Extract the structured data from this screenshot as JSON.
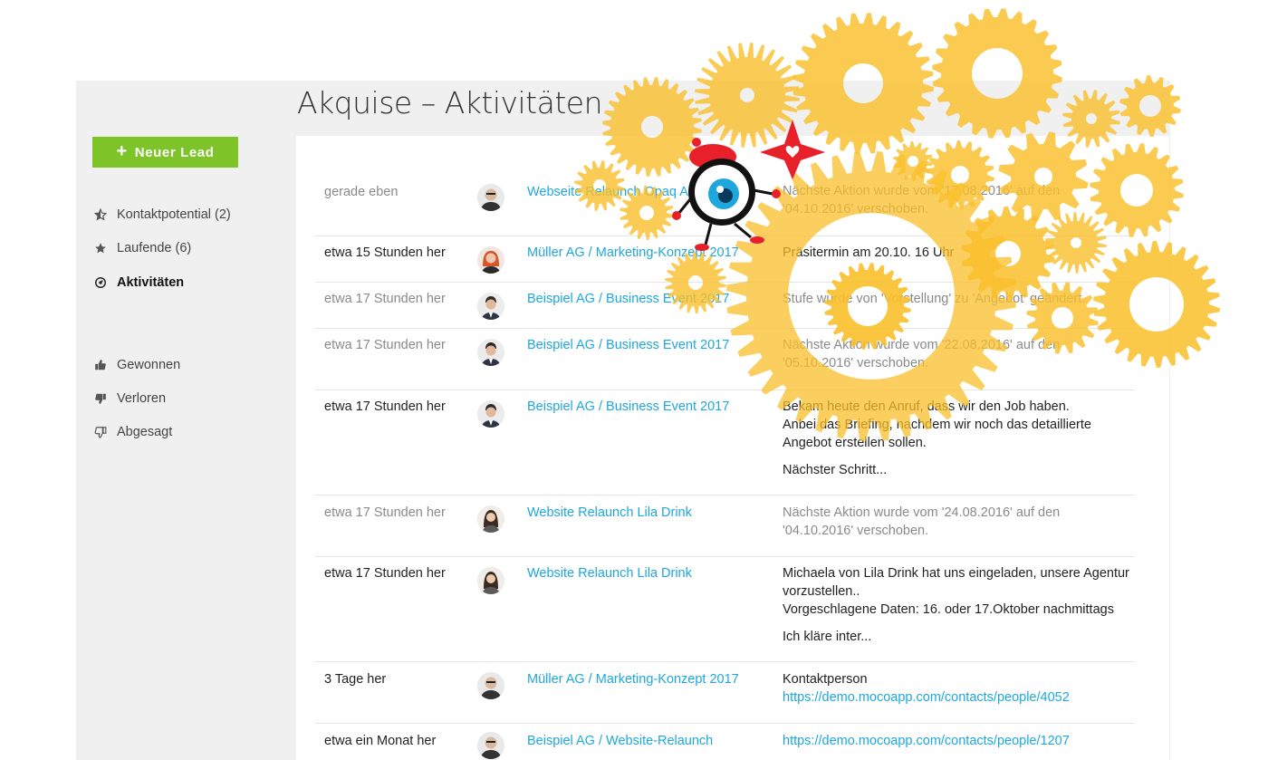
{
  "page": {
    "title": "Akquise – Aktivitäten"
  },
  "sidebar": {
    "new_lead_label": "Neuer Lead",
    "items": [
      {
        "label": "Kontaktpotential (2)",
        "icon": "star-half-icon"
      },
      {
        "label": "Laufende (6)",
        "icon": "star-icon"
      },
      {
        "label": "Aktivitäten",
        "icon": "activity-circle-icon",
        "active": true
      },
      {
        "label": "Gewonnen",
        "icon": "thumbs-up-icon"
      },
      {
        "label": "Verloren",
        "icon": "thumbs-down-icon"
      },
      {
        "label": "Abgesagt",
        "icon": "thumbs-down-outline-icon"
      }
    ]
  },
  "activities": [
    {
      "time": "gerade eben",
      "lead": "Webseite Relaunch Opaq AG",
      "text": [
        "Nächste Aktion wurde vom '17.08.2016' auf den '04.10.2016' verschoben."
      ],
      "muted": true
    },
    {
      "time": "etwa 15 Stunden her",
      "lead": "Müller AG / Marketing-Konzept 2017",
      "text": [
        "Präsitermin am 20.10. 16 Uhr"
      ],
      "muted": false
    },
    {
      "time": "etwa 17 Stunden her",
      "lead": "Beispiel AG / Business Event 2017",
      "text": [
        "Stufe wurde von 'Vorstellung' zu 'Angebot' geändert."
      ],
      "muted": true
    },
    {
      "time": "etwa 17 Stunden her",
      "lead": "Beispiel AG / Business Event 2017",
      "text": [
        "Nächste Aktion wurde vom '22.08.2016' auf den '05.10.2016' verschoben."
      ],
      "muted": true
    },
    {
      "time": "etwa 17 Stunden her",
      "lead": "Beispiel AG / Business Event 2017",
      "text": [
        "Bekam heute den Anruf, dass wir den Job haben.",
        "Anbei das Briefing, nachdem wir noch das detaillierte Angebot erstellen sollen.",
        "Nächster Schritt..."
      ],
      "muted": false
    },
    {
      "time": "etwa 17 Stunden her",
      "lead": "Website Relaunch Lila Drink",
      "text": [
        "Nächste Aktion wurde vom '24.08.2016' auf den '04.10.2016' verschoben."
      ],
      "muted": true
    },
    {
      "time": "etwa 17 Stunden her",
      "lead": "Website Relaunch Lila Drink",
      "text": [
        "Michaela von Lila Drink hat uns eingeladen, unsere Agentur vorzustellen..",
        "Vorgeschlagene Daten: 16. oder 17.Oktober nachmittags",
        "Ich kläre inter..."
      ],
      "muted": false
    },
    {
      "time": "3 Tage her",
      "lead": "Müller AG / Marketing-Konzept 2017",
      "text": [
        "Kontaktperson",
        "https://demo.mocoapp.com/contacts/people/4052"
      ],
      "muted": false
    },
    {
      "time": "etwa ein Monat her",
      "lead": "Beispiel AG / Website-Relaunch",
      "text": [
        "https://demo.mocoapp.com/contacts/people/1207"
      ],
      "muted": false
    }
  ],
  "colors": {
    "accent_green": "#7cc427",
    "link_blue": "#1ea7dd",
    "gear_yellow": "#f9bf2a",
    "mascot_red": "#e8202a"
  }
}
